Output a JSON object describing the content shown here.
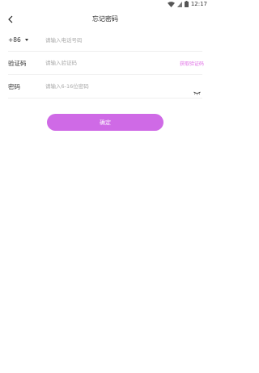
{
  "status_bar": {
    "time": "12:17"
  },
  "nav": {
    "title": "忘记密码"
  },
  "form": {
    "country_code": "+86",
    "phone_placeholder": "请输入电话号码",
    "code_label": "验证码",
    "code_placeholder": "请输入验证码",
    "get_code_label": "获取验证码",
    "password_label": "密码",
    "password_placeholder": "请输入6-16位密码"
  },
  "confirm_label": "确定",
  "colors": {
    "accent": "#cf6ae6",
    "link": "#e070e6"
  },
  "icons": [
    "wifi-icon",
    "signal-icon",
    "battery-icon",
    "back-arrow-icon",
    "caret-down-icon",
    "eye-closed-icon"
  ]
}
